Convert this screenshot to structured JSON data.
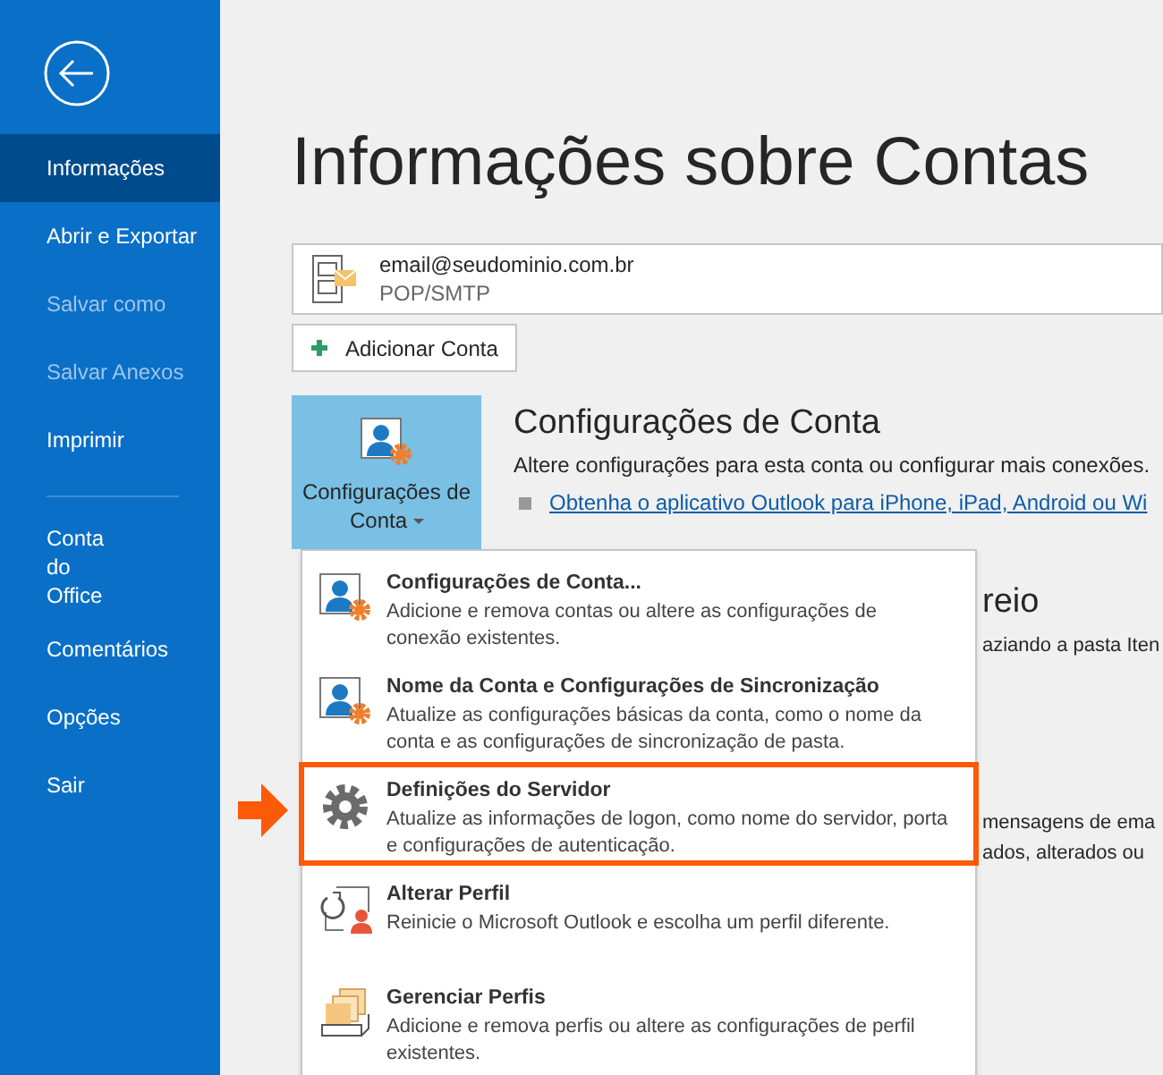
{
  "sidebar": {
    "items": [
      {
        "kind": "item",
        "label": "Informações",
        "selected": true,
        "disabled": false
      },
      {
        "kind": "item",
        "label": "Abrir e Exportar",
        "selected": false,
        "disabled": false
      },
      {
        "kind": "item",
        "label": "Salvar como",
        "selected": false,
        "disabled": true
      },
      {
        "kind": "item",
        "label": "Salvar Anexos",
        "selected": false,
        "disabled": true
      },
      {
        "kind": "item",
        "label": "Imprimir",
        "selected": false,
        "disabled": false
      },
      {
        "kind": "divider"
      },
      {
        "kind": "stacked",
        "label": "Conta do Office",
        "selected": false,
        "disabled": false
      },
      {
        "kind": "item",
        "label": "Comentários",
        "selected": false,
        "disabled": false
      },
      {
        "kind": "item",
        "label": "Opções",
        "selected": false,
        "disabled": false
      },
      {
        "kind": "item",
        "label": "Sair",
        "selected": false,
        "disabled": false
      }
    ]
  },
  "page_title": "Informações sobre Contas",
  "account": {
    "email": "email@seudominio.com.br",
    "type": "POP/SMTP"
  },
  "add_account_button": "Adicionar Conta",
  "settings_button": "Configurações de Conta",
  "settings_section": {
    "title": "Configurações de Conta",
    "description": "Altere configurações para esta conta ou configurar mais conexões.",
    "link": "Obtenha o aplicativo Outlook para iPhone, iPad, Android ou Wi"
  },
  "hidden_text": [
    "reio",
    "aziando a pasta Iten",
    "mensagens de ema",
    "ados, alterados ou"
  ],
  "menu": [
    {
      "kind": "account",
      "title": "Configurações de Conta...",
      "description": "Adicione e remova contas ou altere as configurações de conexão existentes.",
      "highlighted": false
    },
    {
      "kind": "account",
      "title": "Nome da Conta e Configurações de Sincronização",
      "description": "Atualize as configurações básicas da conta, como o nome da conta e as configurações de sincronização de pasta.",
      "highlighted": false
    },
    {
      "kind": "server",
      "title": "Definições do Servidor",
      "description": "Atualize as informações de logon, como nome do servidor, porta e configurações de autenticação.",
      "highlighted": true
    },
    {
      "kind": "profile",
      "title": "Alterar Perfil",
      "description": "Reinicie o Microsoft Outlook e escolha um perfil diferente.",
      "highlighted": false
    },
    {
      "kind": "profiles",
      "title": "Gerenciar Perfis",
      "description": "Adicione e remova perfis ou altere as configurações de perfil existentes.",
      "highlighted": false
    }
  ]
}
